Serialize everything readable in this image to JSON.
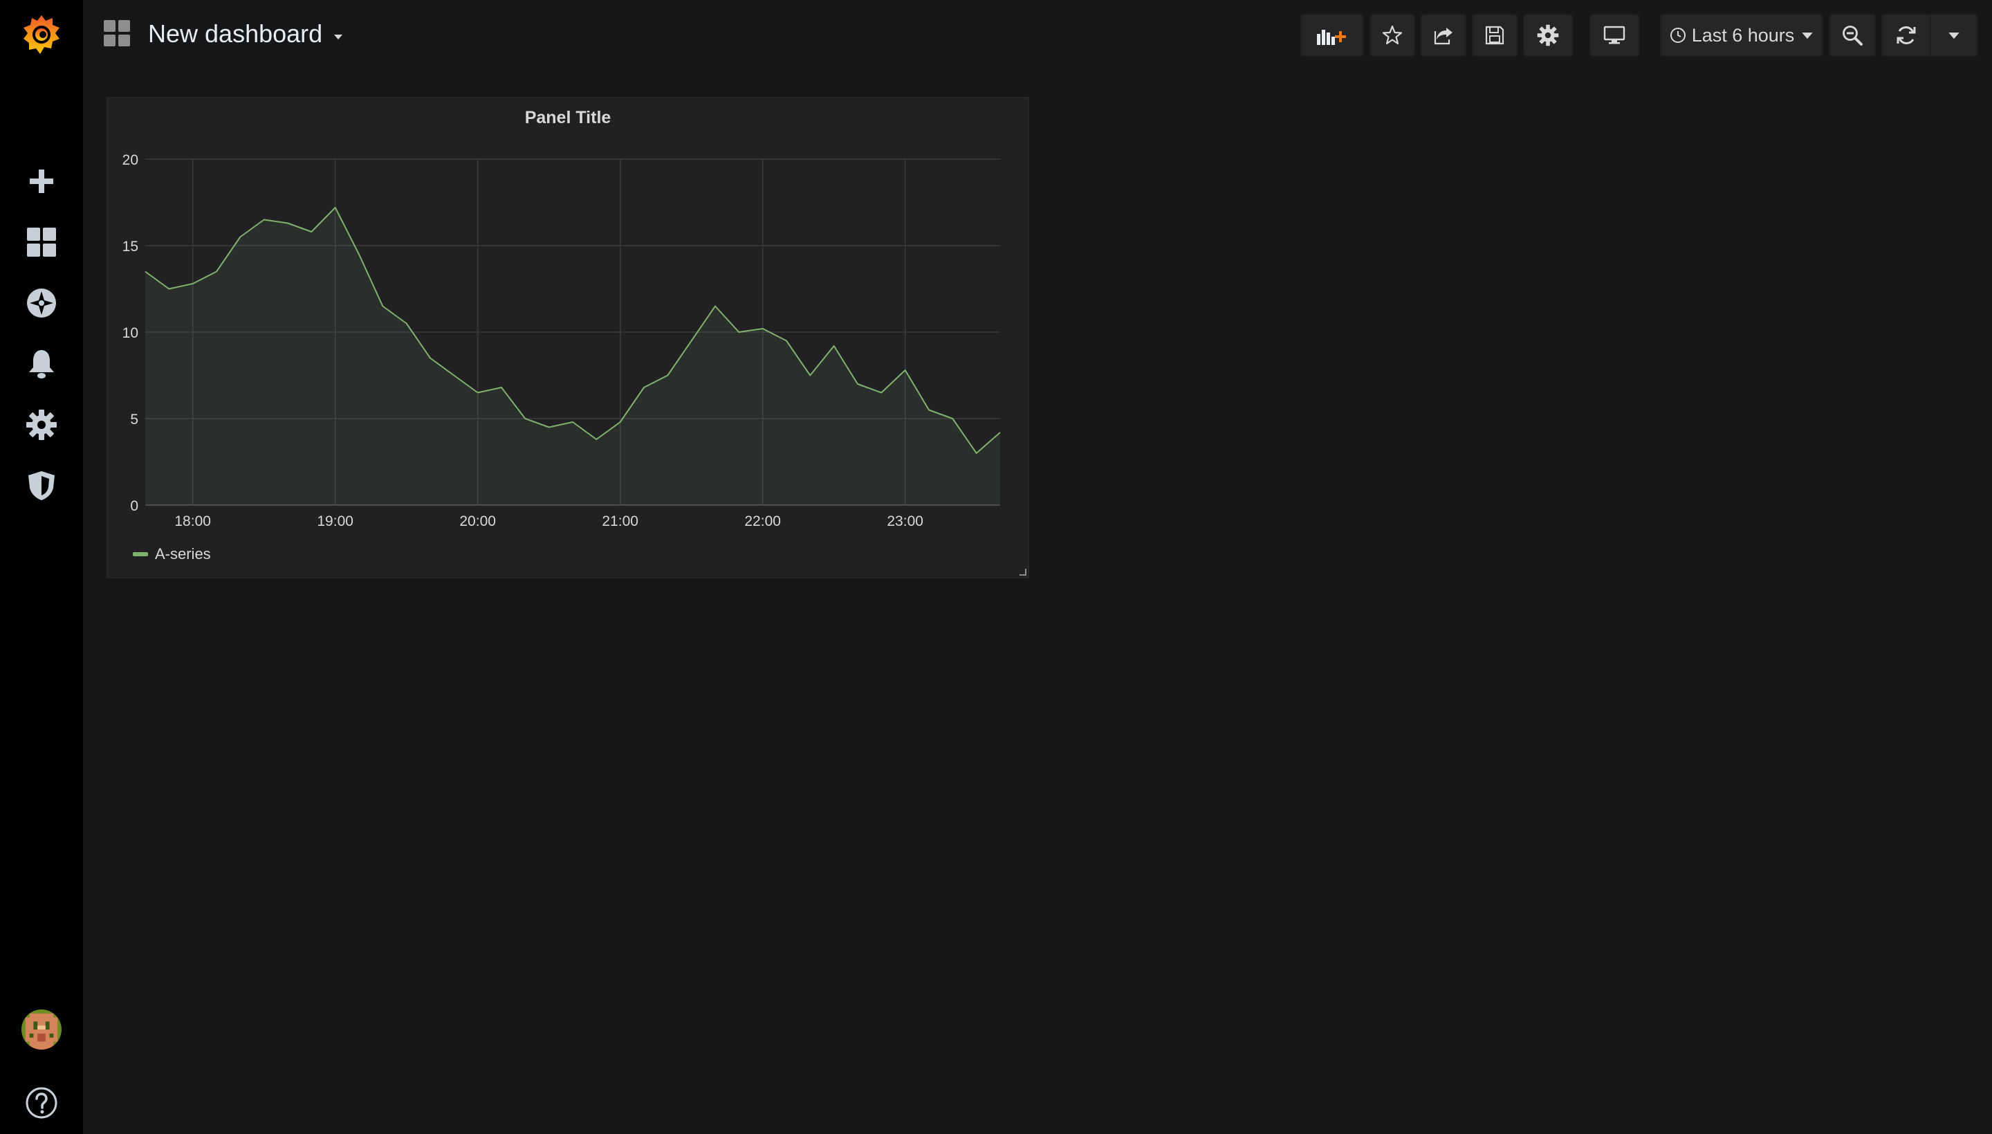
{
  "sidemenu": {
    "logo": "grafana-logo-icon",
    "items": [
      {
        "name": "create",
        "icon": "plus-icon"
      },
      {
        "name": "dashboards",
        "icon": "dashboards-grid-icon"
      },
      {
        "name": "explore",
        "icon": "compass-icon"
      },
      {
        "name": "alerting",
        "icon": "bell-icon"
      },
      {
        "name": "configuration",
        "icon": "gear-icon"
      },
      {
        "name": "server-admin",
        "icon": "shield-icon"
      }
    ],
    "help_icon": "help-icon"
  },
  "header": {
    "dashboard_title": "New dashboard",
    "time_range_label": "Last 6 hours"
  },
  "toolbar": {
    "buttons": [
      "add-panel-icon",
      "star-icon",
      "share-icon",
      "save-icon",
      "settings-icon",
      "tv-mode-icon",
      "zoom-out-icon",
      "refresh-icon",
      "caret-down-icon"
    ]
  },
  "panel": {
    "title": "Panel Title",
    "legend": "A-series"
  },
  "colors": {
    "series": "#7eb26d",
    "background": "#161719",
    "panel": "#212124",
    "sidebar": "#000000"
  },
  "chart_data": {
    "type": "line",
    "title": "Panel Title",
    "series": [
      {
        "name": "A-series",
        "x": [
          "17:40",
          "17:50",
          "18:00",
          "18:10",
          "18:20",
          "18:30",
          "18:40",
          "18:50",
          "19:00",
          "19:10",
          "19:20",
          "19:30",
          "19:40",
          "19:50",
          "20:00",
          "20:10",
          "20:20",
          "20:30",
          "20:40",
          "20:50",
          "21:00",
          "21:10",
          "21:20",
          "21:30",
          "21:40",
          "21:50",
          "22:00",
          "22:10",
          "22:20",
          "22:30",
          "22:40",
          "22:50",
          "23:00",
          "23:10",
          "23:20",
          "23:30",
          "23:40"
        ],
        "values": [
          13.5,
          12.5,
          12.8,
          13.5,
          15.5,
          16.5,
          16.3,
          15.8,
          17.2,
          14.5,
          11.5,
          10.5,
          8.5,
          7.5,
          6.5,
          6.8,
          5.0,
          4.5,
          4.8,
          3.8,
          4.8,
          6.8,
          7.5,
          9.5,
          11.5,
          10.0,
          10.2,
          9.5,
          7.5,
          9.2,
          7.0,
          6.5,
          7.8,
          5.5,
          5.0,
          3.0,
          4.2
        ]
      }
    ],
    "x_ticks": [
      "18:00",
      "19:00",
      "20:00",
      "21:00",
      "22:00",
      "23:00"
    ],
    "y_ticks": [
      "0",
      "5",
      "10",
      "15",
      "20"
    ],
    "ylim": [
      0,
      20
    ],
    "xlim": [
      "17:40",
      "23:40"
    ],
    "grid": true,
    "fill": true,
    "legend_position": "bottom-left"
  }
}
